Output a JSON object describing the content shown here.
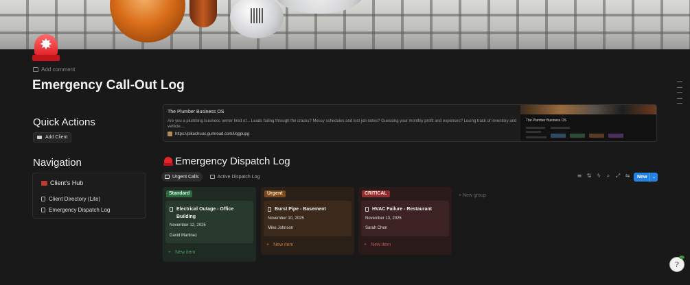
{
  "page": {
    "add_comment": "Add comment",
    "title": "Emergency Call-Out Log",
    "icon": "siren-icon"
  },
  "quick_actions": {
    "heading": "Quick Actions",
    "add_client": "Add Client"
  },
  "navigation": {
    "heading": "Navigation",
    "hub": "Client's Hub",
    "links": [
      "Client Directory (Lite)",
      "Emergency Dispatch Log"
    ]
  },
  "bookmark": {
    "title": "The Plumber Business OS",
    "description": "Are you a plumbing business owner tired of... Leads failing through the cracks? Messy schedules and lost job notes? Guessing your monthly profit and expenses? Losing track of inventory and vehicle ...",
    "url": "https://pikachuux.gumroad.com/l/qgpupg",
    "thumb_title": "The Plumber Business OS"
  },
  "database": {
    "title": "Emergency Dispatch Log",
    "views": [
      "Urgent Calls",
      "Active Dispatch Log"
    ],
    "new_button": "New",
    "new_group": "+ New group",
    "groups": [
      {
        "label": "Standard",
        "color": "#2b6940",
        "cards": [
          {
            "title": "Electrical Outage - Office Building",
            "date": "November 12, 2025",
            "person": "David Martinez"
          }
        ],
        "new_item": "New item"
      },
      {
        "label": "Urgent",
        "color": "#7a4a1e",
        "cards": [
          {
            "title": "Burst Pipe - Basement",
            "date": "November 10, 2025",
            "person": "Mike Johnson"
          }
        ],
        "new_item": "New item"
      },
      {
        "label": "CRITICAL",
        "color": "#8e2e2e",
        "cards": [
          {
            "title": "HVAC Failure - Restaurant",
            "date": "November 13, 2025",
            "person": "Sarah Chen"
          }
        ],
        "new_item": "New item"
      }
    ]
  },
  "help": "?"
}
